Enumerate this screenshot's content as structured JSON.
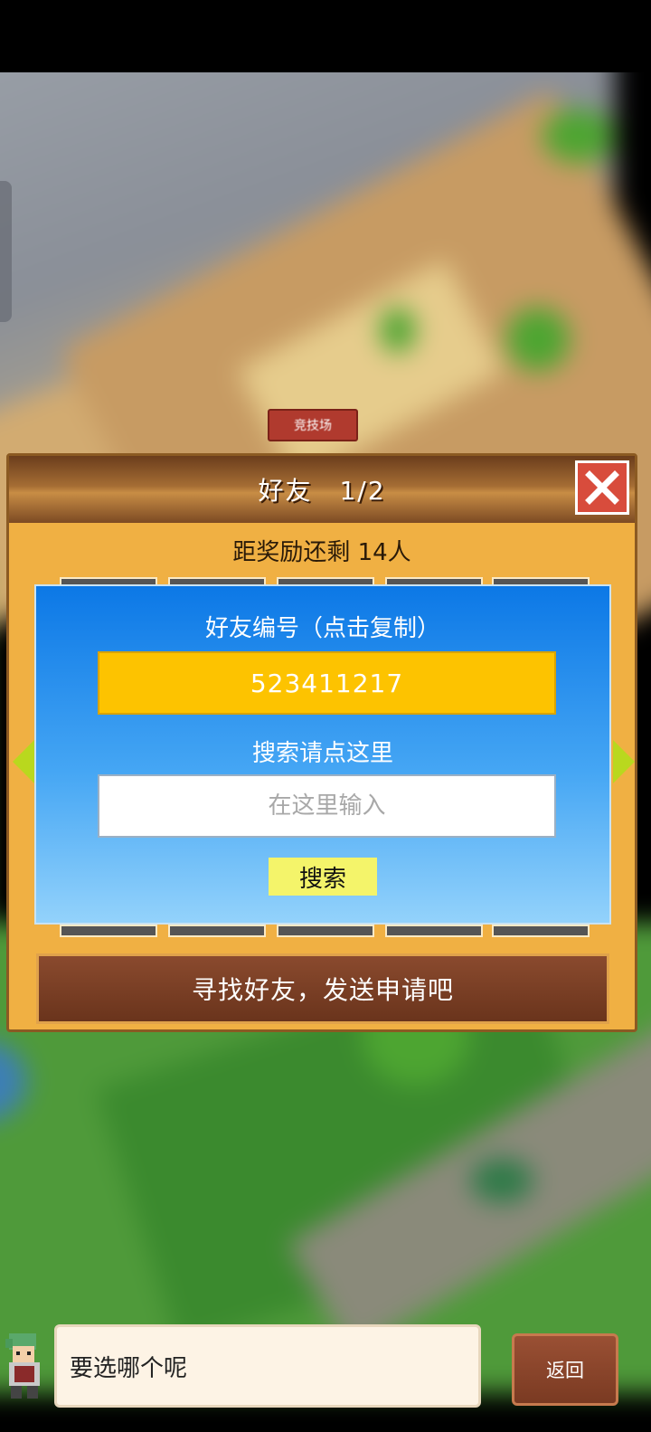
{
  "scene": {
    "arena_label": "竞技场"
  },
  "panel": {
    "title": "好友　1/2",
    "reward_text": "距奖励还剩 14人",
    "close_icon": "close-x-icon",
    "friend_id_heading": "好友编号（点击复制）",
    "friend_id": "523411217",
    "search_heading": "搜索请点这里",
    "search_placeholder": "在这里输入",
    "search_button": "搜索",
    "send_bar": "寻找好友，发送申请吧"
  },
  "bottom": {
    "speech": "要选哪个呢",
    "back_button": "返回"
  },
  "colors": {
    "panel_bg": "#f0b043",
    "id_box": "#fdc300",
    "search_button": "#f4f46a",
    "close_button": "#d84c3c",
    "arrow": "#b9d81e"
  }
}
